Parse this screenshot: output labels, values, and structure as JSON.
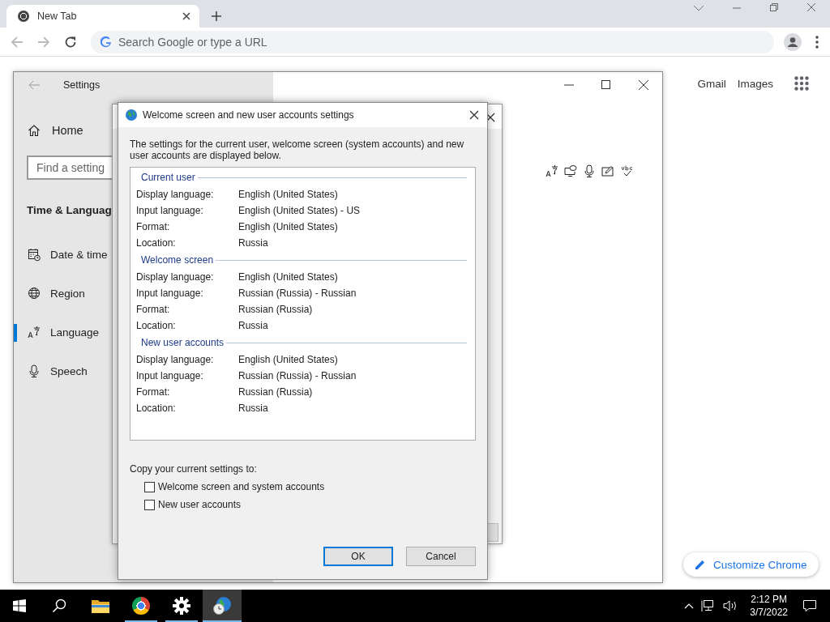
{
  "browser": {
    "tabs": [
      {
        "title": "New Tab",
        "selected": true
      }
    ],
    "omnibox": {
      "placeholder": "Search Google or type a URL"
    },
    "links": [
      "Gmail",
      "Images"
    ],
    "customize_button": "Customize Chrome"
  },
  "settings_window": {
    "title": "Settings",
    "home": "Home",
    "search": {
      "placeholder": "Find a setting"
    },
    "section": "Time & Languag",
    "nav": [
      {
        "label": "Date & time",
        "kind": "calendar",
        "selected": false
      },
      {
        "label": "Region",
        "kind": "globe",
        "selected": false
      },
      {
        "label": "Language",
        "kind": "language",
        "selected": true
      },
      {
        "label": "Speech",
        "kind": "mic",
        "selected": false
      }
    ]
  },
  "dialog": {
    "title": "Welcome screen and new user accounts settings",
    "intro": "The settings for the current user, welcome screen (system accounts) and new user accounts are displayed below.",
    "groups": [
      {
        "title": "Current user",
        "rows": [
          {
            "label": "Display language:",
            "value": "English (United States)"
          },
          {
            "label": "Input language:",
            "value": "English (United States) - US"
          },
          {
            "label": "Format:",
            "value": "English (United States)"
          },
          {
            "label": "Location:",
            "value": "Russia"
          }
        ]
      },
      {
        "title": "Welcome screen",
        "rows": [
          {
            "label": "Display language:",
            "value": "English (United States)"
          },
          {
            "label": "Input language:",
            "value": "Russian (Russia) - Russian"
          },
          {
            "label": "Format:",
            "value": "Russian (Russia)"
          },
          {
            "label": "Location:",
            "value": "Russia"
          }
        ]
      },
      {
        "title": "New user accounts",
        "rows": [
          {
            "label": "Display language:",
            "value": "English (United States)"
          },
          {
            "label": "Input language:",
            "value": "Russian (Russia) - Russian"
          },
          {
            "label": "Format:",
            "value": "Russian (Russia)"
          },
          {
            "label": "Location:",
            "value": "Russia"
          }
        ]
      }
    ],
    "copy_label": "Copy your current settings to:",
    "checkboxes": [
      {
        "label": "Welcome screen and system accounts",
        "checked": false
      },
      {
        "label": "New user accounts",
        "checked": false
      }
    ],
    "buttons": [
      {
        "label": "OK",
        "default": true
      },
      {
        "label": "Cancel",
        "default": false
      }
    ]
  },
  "taskbar": {
    "apps": [
      {
        "kind": "explorer",
        "running": false,
        "active": false
      },
      {
        "kind": "chrome",
        "running": true,
        "active": false
      },
      {
        "kind": "settings",
        "running": true,
        "active": false
      },
      {
        "kind": "region",
        "running": true,
        "active": true
      }
    ],
    "clock": {
      "time": "2:12 PM",
      "date": "3/7/2022"
    }
  }
}
